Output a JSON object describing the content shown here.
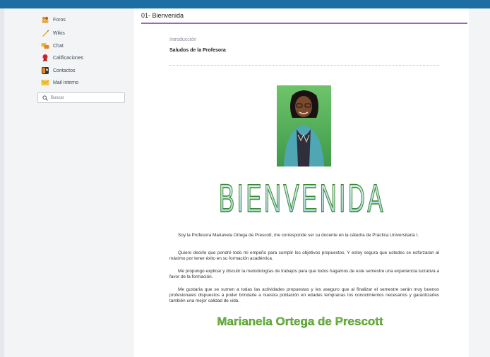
{
  "sidebar": {
    "items": [
      {
        "label": "Foros",
        "icon": "forum-icon"
      },
      {
        "label": "Wikis",
        "icon": "wiki-icon"
      },
      {
        "label": "Chat",
        "icon": "chat-icon"
      },
      {
        "label": "Calificaciones",
        "icon": "grades-icon"
      },
      {
        "label": "Contactos",
        "icon": "contacts-icon"
      },
      {
        "label": "Mail interno",
        "icon": "mail-icon"
      }
    ],
    "search_label": "Buscar"
  },
  "main": {
    "title": "01- Bienvenida",
    "section_label": "Introducción",
    "subtitle": "Saludos de la Profesora",
    "welcome_banner": "BIENVENIDA",
    "paragraphs": [
      "Soy la Profesora Marianela Ortega de Prescott, me corresponde ser su docente en la cátedra de Práctica Universitaria I.",
      "Quiero decirle que pondré todo mi empeño para cumplir los objetivos propuestos.  Y estoy segura que ustedes se esforzaran al máximo por tener éxito en su formación académica.",
      "Me propongo explicar y discutir la metodologías de trabajos para que todos hagamos de este semestre una experiencia lucrativa a favor de la formación.",
      "Me gustaría que se sumen a todas las actividades propuestas y les aseguro que al finalizar el semestre serán muy buenos profesionales dispuestos a poder brindarle a nuestra población en edades tempranas los conocimientos necesarios y garantizarles también una mejor calidad de vida."
    ],
    "signature": "Marianela Ortega de Prescott"
  },
  "colors": {
    "topbar": "#1d6fa3",
    "title_rule": "#8e6bbd",
    "welcome_fill": "#cfe8ef",
    "welcome_stroke": "#3d8a2e",
    "signature": "#6fb33a"
  }
}
